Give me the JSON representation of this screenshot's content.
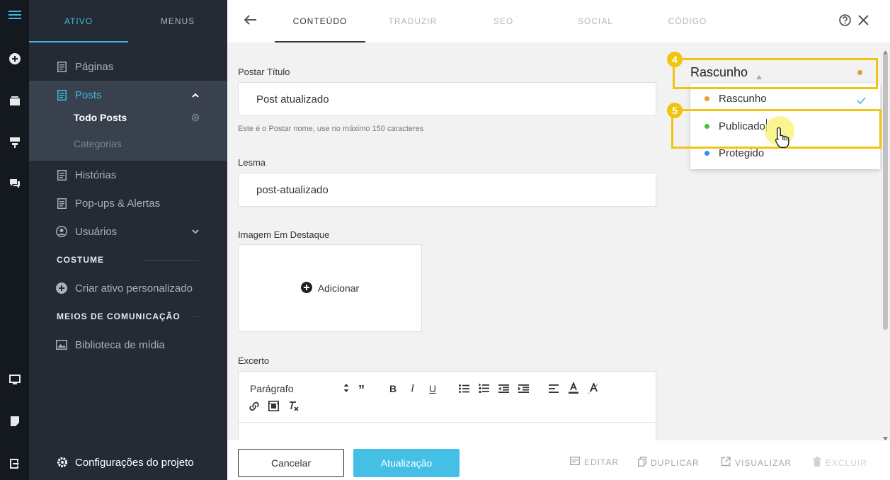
{
  "sidebar": {
    "tabs": [
      {
        "label": "ATIVO"
      },
      {
        "label": "MENUS"
      }
    ],
    "items": [
      {
        "label": "Páginas",
        "icon": "page-icon"
      },
      {
        "label": "Posts",
        "icon": "posts-icon"
      },
      {
        "label": "Histórias",
        "icon": "page-icon"
      },
      {
        "label": "Pop-ups & Alertas",
        "icon": "page-icon"
      },
      {
        "label": "Usuários",
        "icon": "user-icon"
      }
    ],
    "posts_sub": [
      {
        "label": "Todo Posts"
      },
      {
        "label": "Categorias"
      }
    ],
    "sections": [
      {
        "title": "COSTUME",
        "item": "Criar ativo personalizado"
      },
      {
        "title": "MEIOS DE COMUNICAÇÃO",
        "item": "Biblioteca de mídia"
      }
    ],
    "settings_label": "Configurações do projeto"
  },
  "tabs": [
    {
      "label": "CONTEÚDO"
    },
    {
      "label": "TRADUZIR"
    },
    {
      "label": "SEO"
    },
    {
      "label": "SOCIAL"
    },
    {
      "label": "CÓDIGO"
    }
  ],
  "form": {
    "title_label": "Postar Título",
    "title_value": "Post atualizado",
    "title_hint": "Este é o Postar nome, use no máximo 150 caracteres",
    "slug_label": "Lesma",
    "slug_value": "post-atualizado",
    "image_label": "Imagem Em Destaque",
    "image_add": "Adicionar",
    "excerpt_label": "Excerto",
    "editor_format": "Parágrafo"
  },
  "status": {
    "current": "Rascunho",
    "options": [
      {
        "label": "Rascunho",
        "color": "#e0a030",
        "selected": true
      },
      {
        "label": "Publicado",
        "color": "#3cc33c",
        "selected": false
      },
      {
        "label": "Protegido",
        "color": "#2e8df0",
        "selected": false
      }
    ],
    "callouts": [
      "4",
      "5"
    ]
  },
  "footer": {
    "cancel": "Cancelar",
    "update": "Atualização",
    "actions": [
      {
        "label": "EDITAR",
        "icon": "edit-icon"
      },
      {
        "label": "DUPLICAR",
        "icon": "duplicate-icon"
      },
      {
        "label": "VISUALIZAR",
        "icon": "external-link-icon"
      },
      {
        "label": "EXCLUIR",
        "icon": "trash-icon"
      }
    ]
  },
  "colors": {
    "accent": "#44c0e7",
    "callout": "#f1c40f",
    "sidebar": "#242b35"
  }
}
